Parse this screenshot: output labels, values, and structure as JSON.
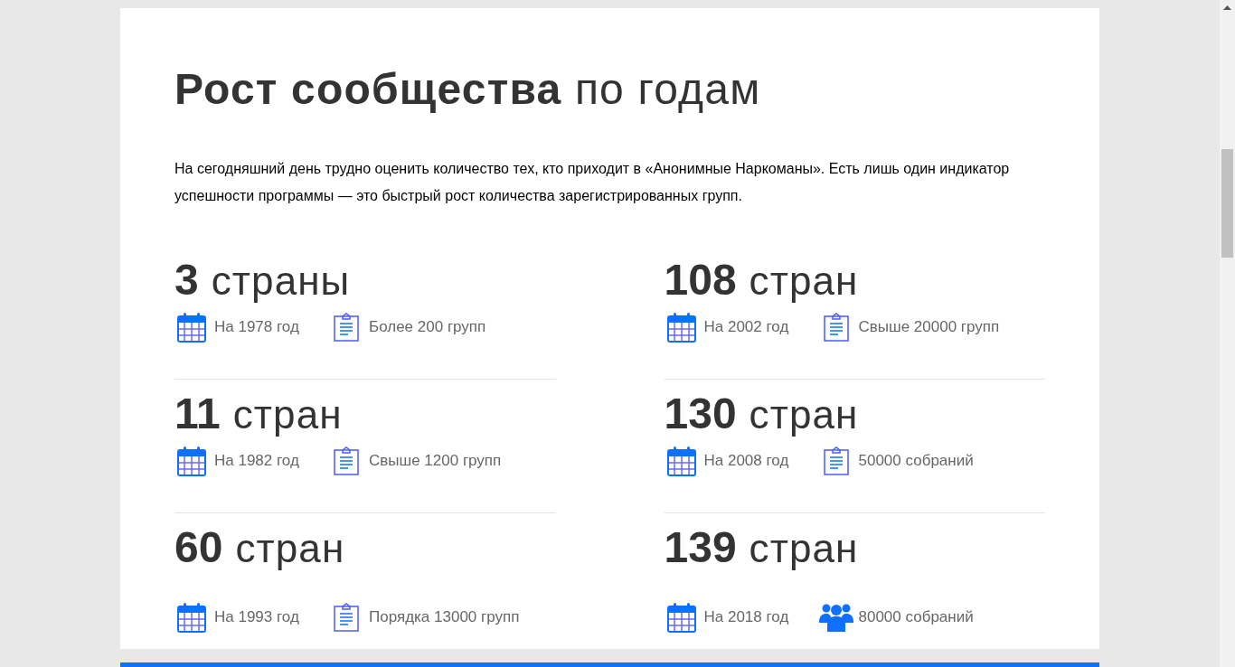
{
  "heading": "**Рост сообщества** по годам",
  "intro": "На сегодняшний день трудно оценить количество тех, кто приходит в «Анонимные Наркоманы». Есть лишь один индикатор успешности программы — это быстрый рост количества зарегистрированных групп.",
  "stats": [
    {
      "number": "3",
      "unit": "страны",
      "facts": [
        {
          "kind": "calendar",
          "text": "На 1978 год"
        },
        {
          "kind": "clipboard",
          "text": "Более 200 групп"
        }
      ]
    },
    {
      "number": "108",
      "unit": "стран",
      "facts": [
        {
          "kind": "calendar",
          "text": "На 2002 год"
        },
        {
          "kind": "clipboard",
          "text": "Свыше 20000 групп"
        }
      ]
    },
    {
      "number": "11",
      "unit": "стран",
      "facts": [
        {
          "kind": "calendar",
          "text": "На 1982 год"
        },
        {
          "kind": "clipboard",
          "text": "Свыше 1200 групп"
        }
      ]
    },
    {
      "number": "130",
      "unit": "стран",
      "facts": [
        {
          "kind": "calendar",
          "text": "На 2008 год"
        },
        {
          "kind": "clipboard",
          "text": "50000 собраний"
        }
      ]
    },
    {
      "number": "60",
      "unit": "стран",
      "facts": [
        {
          "kind": "calendar",
          "text": "На 1993 год"
        },
        {
          "kind": "clipboard",
          "text": "Порядка 13000 групп"
        }
      ]
    },
    {
      "number": "139",
      "unit": "стран",
      "facts": [
        {
          "kind": "calendar",
          "text": "На 2018 год"
        },
        {
          "kind": "people",
          "text": "80000 собраний"
        }
      ]
    }
  ]
}
